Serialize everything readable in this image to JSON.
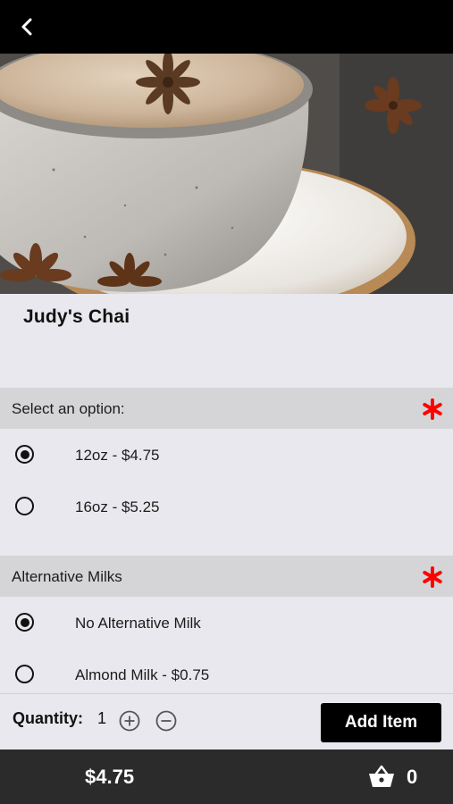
{
  "product": {
    "title": "Judy's Chai"
  },
  "sections": [
    {
      "label": "Select an option:",
      "required": true,
      "options": [
        {
          "label": "12oz - $4.75",
          "selected": true
        },
        {
          "label": "16oz - $5.25",
          "selected": false
        }
      ]
    },
    {
      "label": "Alternative Milks",
      "required": true,
      "options": [
        {
          "label": "No Alternative Milk",
          "selected": true
        },
        {
          "label": "Almond Milk - $0.75",
          "selected": false
        }
      ]
    }
  ],
  "quantity": {
    "label": "Quantity:",
    "value": "1"
  },
  "actions": {
    "add_item_label": "Add Item"
  },
  "footer": {
    "total": "$4.75",
    "cart_count": "0"
  },
  "colors": {
    "topbar": "#000000",
    "required_asterisk": "#ff0000",
    "footer": "#2b2b2b",
    "background": "#e9e8ee",
    "section_header": "#d5d5d7"
  },
  "icons": [
    "back-chevron-icon",
    "required-asterisk-icon",
    "radio-button",
    "plus-circle-icon",
    "minus-circle-icon",
    "cart-basket-icon"
  ]
}
